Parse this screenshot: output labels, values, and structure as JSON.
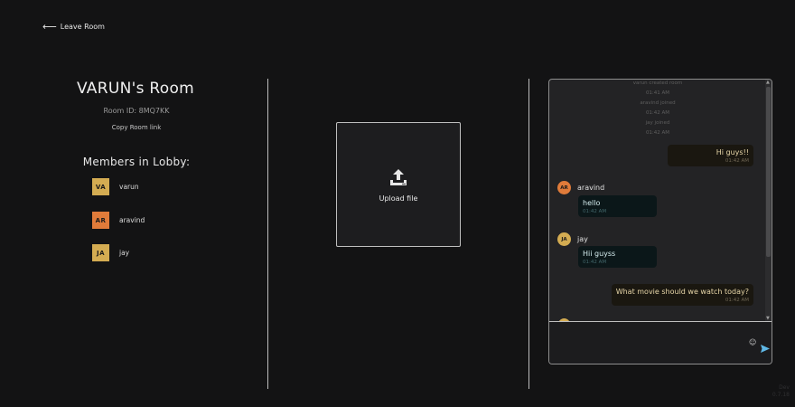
{
  "nav": {
    "leave_label": "Leave Room"
  },
  "room": {
    "title": "VARUN's Room",
    "id_text": "Room ID: 8MQ7KK",
    "copy_link_label": "Copy Room link",
    "members_title": "Members in Lobby:"
  },
  "members": [
    {
      "initials": "VA",
      "name": "varun",
      "color": "#d4ac52"
    },
    {
      "initials": "AR",
      "name": "aravind",
      "color": "#e07b3a"
    },
    {
      "initials": "JA",
      "name": "jay",
      "color": "#d4ac52"
    }
  ],
  "upload": {
    "label": "Upload file",
    "icon": "upload-icon"
  },
  "chat": {
    "system": [
      {
        "text": "varun created room",
        "time": "01:41 AM"
      },
      {
        "text": "aravind joined",
        "time": "01:42 AM"
      },
      {
        "text": "jay joined",
        "time": "01:42 AM"
      }
    ],
    "messages": [
      {
        "text": "Hi guys!!",
        "time": "01:42 AM"
      },
      {
        "sender": "aravind",
        "initials": "AR",
        "avatar_color": "#e07b3a",
        "text": "hello",
        "time": "01:42 AM"
      },
      {
        "sender": "jay",
        "initials": "JA",
        "avatar_color": "#d4ac52",
        "text": "Hii guyss",
        "time": "01:42 AM"
      },
      {
        "text": "What movie should we watch today?",
        "time": "01:42 AM"
      }
    ],
    "input_placeholder": "",
    "emoji_icon": "emoji-icon",
    "send_icon": "send-icon"
  },
  "watermark": {
    "line1": "Dev",
    "line2": "0.7.18"
  }
}
